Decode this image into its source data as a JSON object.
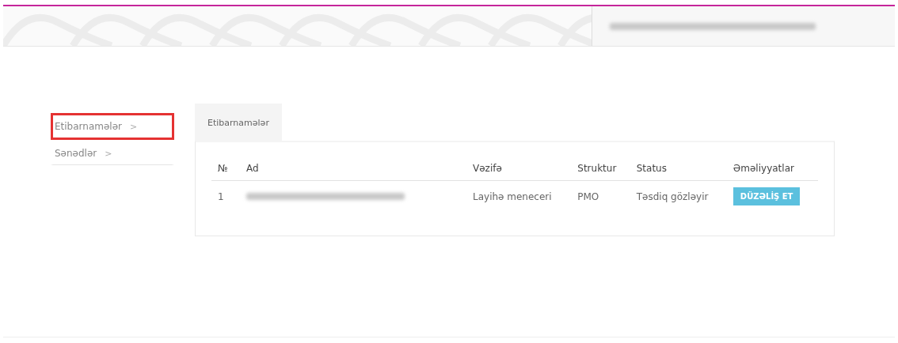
{
  "sidebar": {
    "items": [
      {
        "label": "Etibarnamələr",
        "chevron": ">",
        "highlighted": true
      },
      {
        "label": "Sənədlər",
        "chevron": ">",
        "highlighted": false
      }
    ]
  },
  "tabs": [
    {
      "label": "Etibarnamələr",
      "selected": true
    }
  ],
  "table": {
    "columns": [
      "№",
      "Ad",
      "Vəzifə",
      "Struktur",
      "Status",
      "Əməliyyatlar"
    ],
    "rows": [
      {
        "number": "1",
        "name_redacted": true,
        "position": "Layihə meneceri",
        "structure": "PMO",
        "status": "Təsdiq gözləyir",
        "action": "DÜZƏLİŞ ET"
      }
    ]
  }
}
